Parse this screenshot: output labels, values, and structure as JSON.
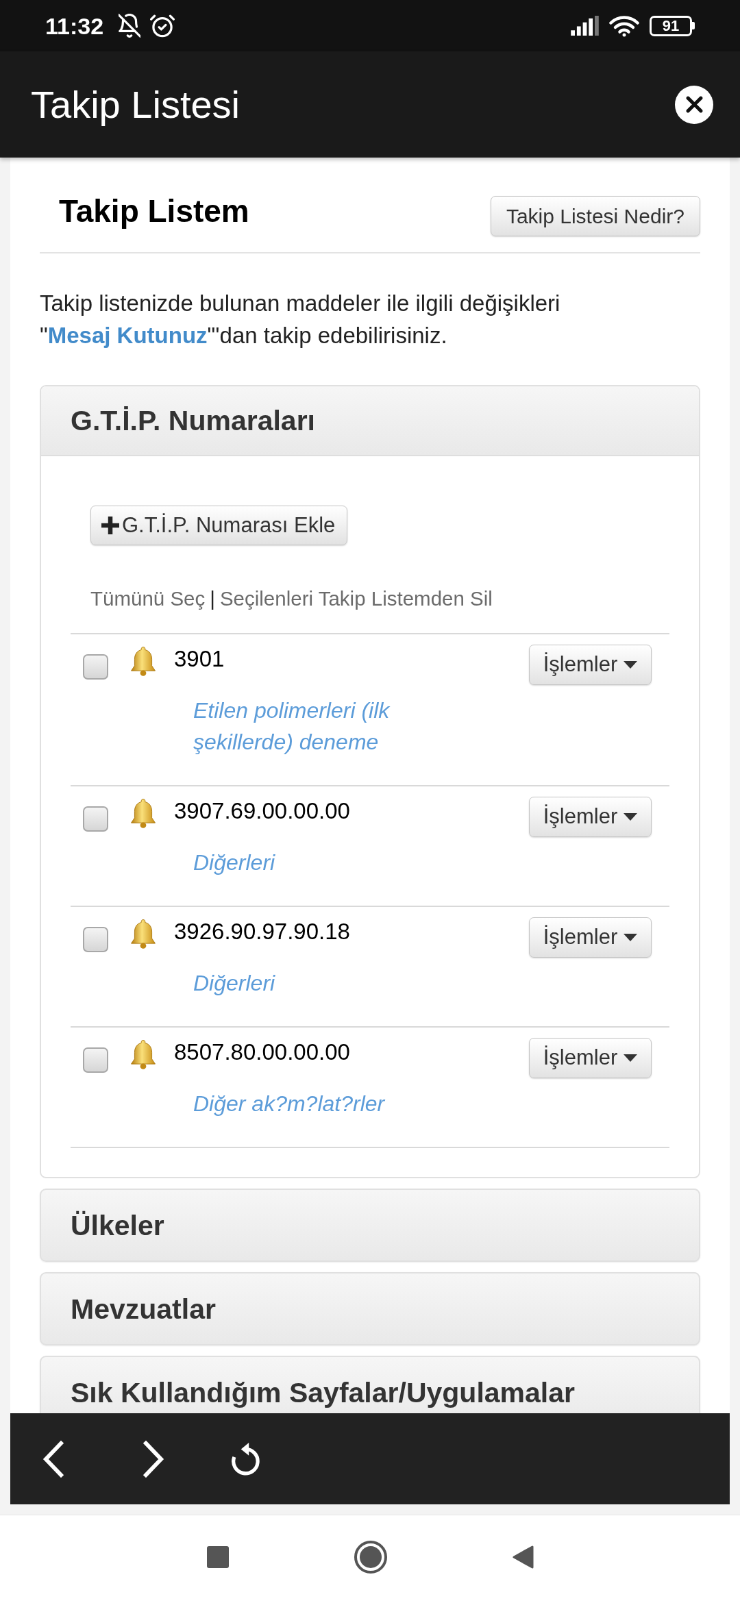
{
  "status_bar": {
    "time": "11:32",
    "battery": "91"
  },
  "app_bar": {
    "title": "Takip Listesi"
  },
  "page": {
    "heading": "Takip Listem",
    "help_button": "Takip Listesi Nedir?",
    "intro": {
      "text_before": "Takip listenizde bulunan maddeler ile ilgili değişikleri \"",
      "link": "Mesaj Kutunuz",
      "text_after": "\"'dan takip edebilirisiniz."
    }
  },
  "sections": [
    {
      "title": "G.T.İ.P. Numaraları",
      "expanded": true,
      "add_button": "G.T.İ.P. Numarası Ekle",
      "select_all": "Tümünü Seç",
      "separator": "|",
      "delete_selected": "Seçilenleri Takip Listemden Sil",
      "items": [
        {
          "code": "3901",
          "description": "Etilen polimerleri (ilk şekillerde) deneme",
          "checked": false,
          "actions": "İşlemler"
        },
        {
          "code": "3907.69.00.00.00",
          "description": "Diğerleri",
          "checked": false,
          "actions": "İşlemler"
        },
        {
          "code": "3926.90.97.90.18",
          "description": "Diğerleri",
          "checked": false,
          "actions": "İşlemler"
        },
        {
          "code": "8507.80.00.00.00",
          "description": "Diğer ak?m?lat?rler",
          "checked": false,
          "actions": "İşlemler"
        }
      ]
    },
    {
      "title": "Ülkeler",
      "expanded": false
    },
    {
      "title": "Mevzuatlar",
      "expanded": false
    },
    {
      "title": "Sık Kullandığım Sayfalar/Uygulamalar",
      "expanded": false
    }
  ]
}
